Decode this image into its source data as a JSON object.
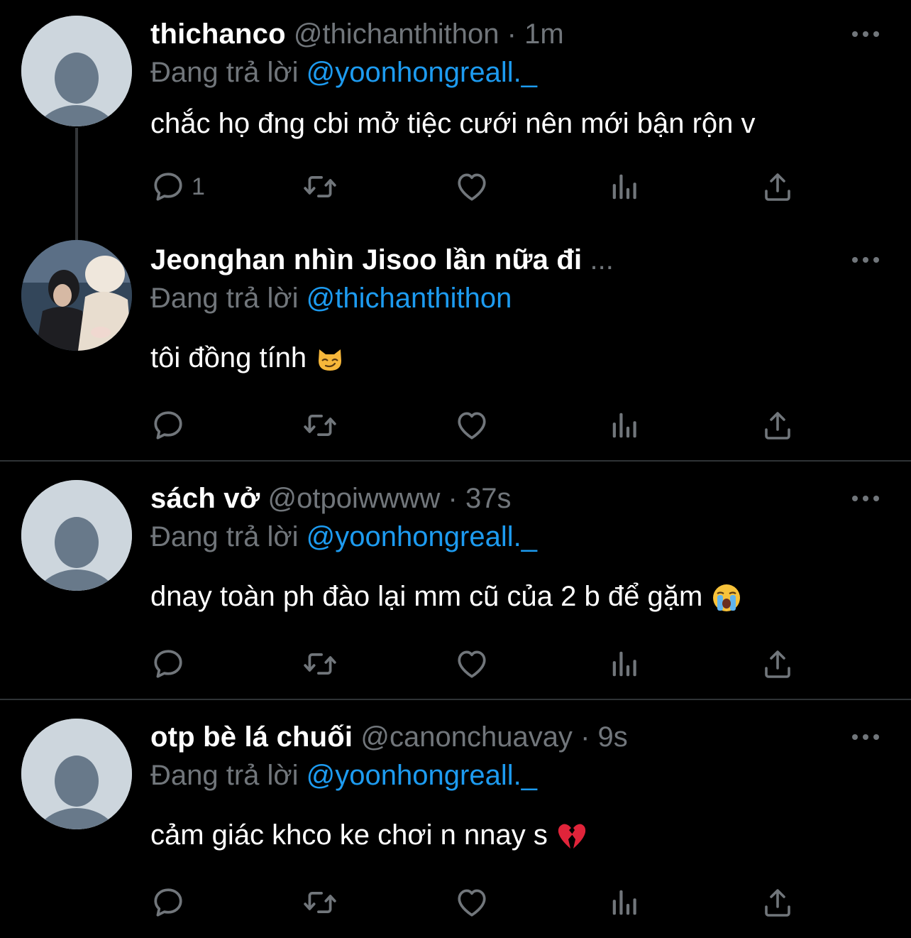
{
  "colors": {
    "background": "#000000",
    "text_primary": "#ffffff",
    "text_secondary": "#71767b",
    "link": "#1d9bf0",
    "divider": "#2f3336"
  },
  "reply_prefix": "Đang trả lời",
  "tweets": [
    {
      "name": "thichanco",
      "handle": "@thichanthithon",
      "separator": "·",
      "time": "1m",
      "reply_to": "@yoonhongreall._",
      "text": "chắc họ đng cbi mở tiệc cưới nên mới bận rộn v",
      "reply_count": "1"
    },
    {
      "name": "Jeonghan nhìn Jisoo lần nữa đi",
      "name_ellipsis": "...",
      "reply_to": "@thichanthithon",
      "text": "tôi đồng tính",
      "emoji": "smirking-cat-emoji"
    },
    {
      "name": "sách vở",
      "handle": "@otpoiwwww",
      "separator": "·",
      "time": "37s",
      "reply_to": "@yoonhongreall._",
      "text": "dnay toàn ph đào lại mm cũ của 2 b để gặm",
      "emoji": "loudly-crying-face-emoji"
    },
    {
      "name": "otp bè lá chuối",
      "handle": "@canonchuavay",
      "separator": "·",
      "time": "9s",
      "reply_to": "@yoonhongreall._",
      "text": "cảm giác khco ke chơi n nnay s",
      "emoji": "broken-heart-emoji"
    }
  ],
  "icons": [
    "reply-icon",
    "retweet-icon",
    "like-icon",
    "views-icon",
    "share-icon",
    "more-icon"
  ]
}
